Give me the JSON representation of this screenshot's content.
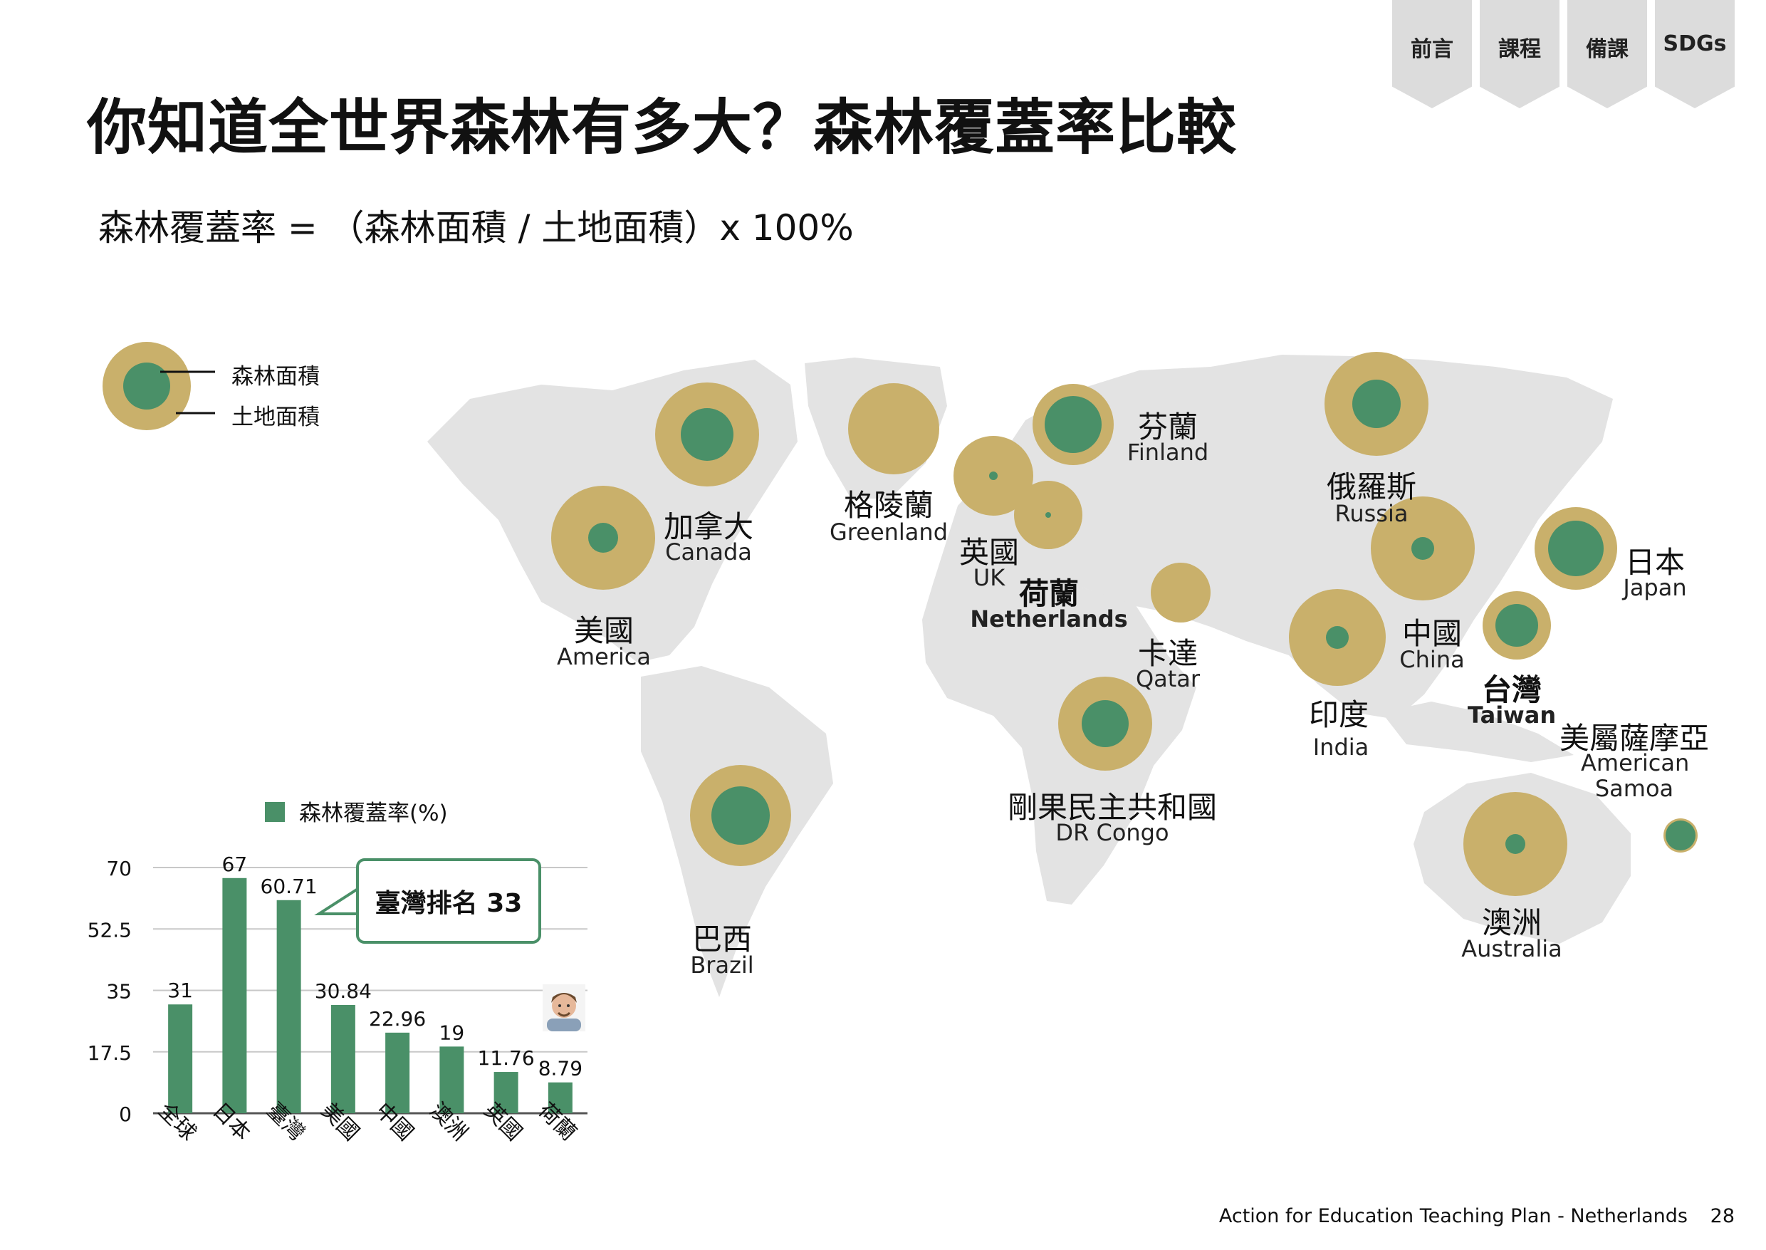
{
  "nav": {
    "tabs": [
      "前言",
      "課程",
      "備課",
      "SDGs"
    ]
  },
  "title": "你知道全世界森林有多大？森林覆蓋率比較",
  "formula": "森林覆蓋率 = （森林面積 / 土地面積）x 100%",
  "legend": {
    "forest_area": "森林面積",
    "land_area": "土地面積"
  },
  "map": {
    "countries": [
      {
        "zh": "加拿大",
        "en": "Canada"
      },
      {
        "zh": "美國",
        "en": "America"
      },
      {
        "zh": "格陵蘭",
        "en": "Greenland"
      },
      {
        "zh": "英國",
        "en": "UK"
      },
      {
        "zh": "荷蘭",
        "en": "Netherlands"
      },
      {
        "zh": "芬蘭",
        "en": "Finland"
      },
      {
        "zh": "卡達",
        "en": "Qatar"
      },
      {
        "zh": "剛果民主共和國",
        "en": "DR Congo"
      },
      {
        "zh": "巴西",
        "en": "Brazil"
      },
      {
        "zh": "俄羅斯",
        "en": "Russia"
      },
      {
        "zh": "中國",
        "en": "China"
      },
      {
        "zh": "印度",
        "en": "India"
      },
      {
        "zh": "台灣",
        "en": "Taiwan"
      },
      {
        "zh": "日本",
        "en": "Japan"
      },
      {
        "zh": "美屬薩摩亞",
        "en": "American Samoa"
      },
      {
        "zh": "澳洲",
        "en": "Australia"
      }
    ]
  },
  "callout": "臺灣排名 33",
  "colors": {
    "forest": "#4a9068",
    "land": "#c9b06b",
    "map": "#e3e3e3",
    "grid": "#c8c8c8"
  },
  "chart_data": {
    "type": "bar",
    "categories": [
      "全球",
      "日本",
      "臺灣",
      "美國",
      "中國",
      "澳洲",
      "英國",
      "荷蘭"
    ],
    "series": [
      {
        "name": "森林覆蓋率(%)",
        "values": [
          31,
          67,
          60.71,
          30.84,
          22.96,
          19,
          11.76,
          8.79
        ]
      }
    ],
    "yticks": [
      "0",
      "17.5",
      "35",
      "52.5",
      "70"
    ],
    "ylim": [
      0,
      70
    ],
    "grid": true,
    "legend_position": "top"
  },
  "footer": "Action for Education Teaching Plan - Netherlands",
  "page_number": "28"
}
